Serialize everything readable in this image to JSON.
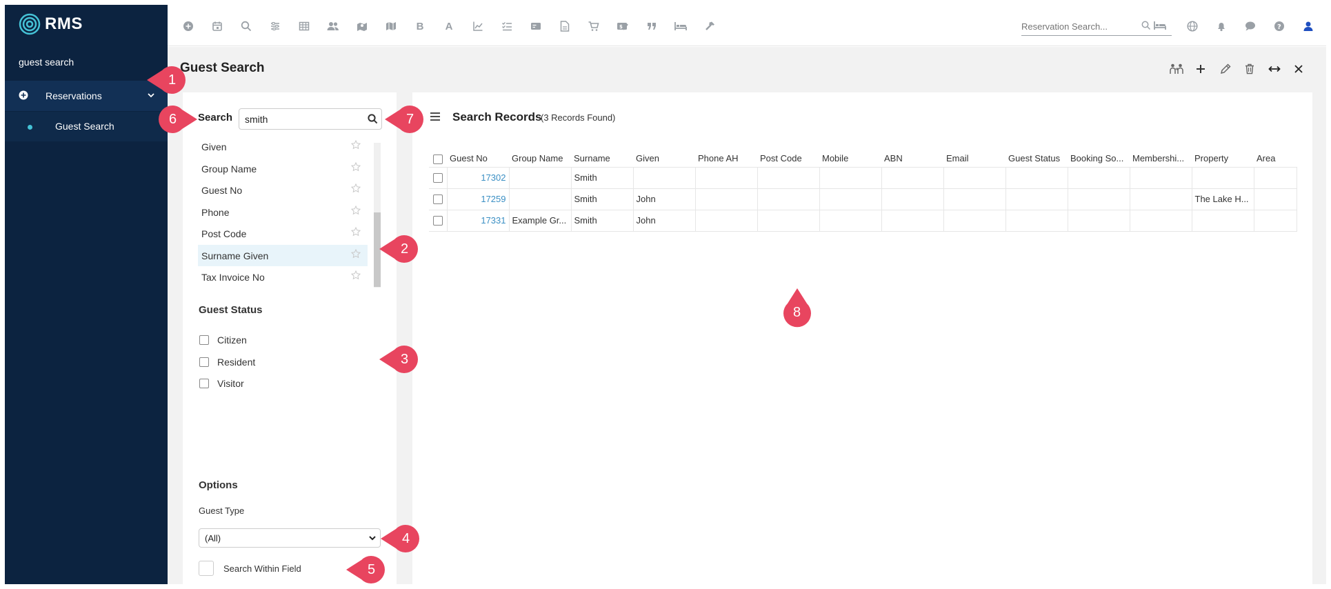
{
  "app": {
    "logo_text": "RMS"
  },
  "sidebar": {
    "search_text": "guest search",
    "group_label": "Reservations",
    "sub_item_label": "Guest Search"
  },
  "topbar": {
    "tool_icons": [
      "plus-circle-icon",
      "calendar-icon",
      "search-icon",
      "sliders-icon",
      "grid-icon",
      "users-icon",
      "map-pin-icon",
      "map-icon",
      "bold-b-icon",
      "letter-a-icon",
      "line-chart-icon",
      "checklist-icon",
      "id-card-icon",
      "document-icon",
      "cart-icon",
      "tag-icon",
      "quote-icon",
      "bed-icon",
      "hammer-icon"
    ],
    "reservation_search_placeholder": "Reservation Search...",
    "right_icons": [
      "globe-icon",
      "bell-icon",
      "chat-icon",
      "help-icon",
      "user-icon"
    ]
  },
  "page": {
    "title": "Guest Search"
  },
  "search": {
    "label": "Search",
    "value": "smith",
    "fields": [
      "Given",
      "Group Name",
      "Guest No",
      "Phone",
      "Post Code",
      "Surname Given",
      "Tax Invoice No"
    ],
    "selected_field": "Surname Given"
  },
  "guest_status": {
    "title": "Guest Status",
    "options": [
      "Citizen",
      "Resident",
      "Visitor"
    ]
  },
  "options": {
    "title": "Options",
    "guest_type_label": "Guest Type",
    "guest_type_value": "(All)",
    "search_within_field_label": "Search Within Field"
  },
  "records": {
    "title": "Search Records",
    "count_text": "(3 Records Found)",
    "columns": [
      "Guest No",
      "Group Name",
      "Surname",
      "Given",
      "Phone AH",
      "Post Code",
      "Mobile",
      "ABN",
      "Email",
      "Guest Status",
      "Booking So...",
      "Membershi...",
      "Property",
      "Area"
    ],
    "rows": [
      [
        "17302",
        "",
        "Smith",
        "",
        "",
        "",
        "",
        "",
        "",
        "",
        "",
        "",
        "",
        ""
      ],
      [
        "17259",
        "",
        "Smith",
        "John",
        "",
        "",
        "",
        "",
        "",
        "",
        "",
        "",
        "The Lake H...",
        ""
      ],
      [
        "17331",
        "Example Gr...",
        "Smith",
        "John",
        "",
        "",
        "",
        "",
        "",
        "",
        "",
        "",
        "",
        ""
      ]
    ]
  },
  "callouts": [
    "1",
    "2",
    "3",
    "4",
    "5",
    "6",
    "7",
    "8"
  ],
  "colors": {
    "sidebar": "#0c2340",
    "accent": "#45c2d6",
    "callout": "#e8455f",
    "link": "#3a8fc4"
  }
}
